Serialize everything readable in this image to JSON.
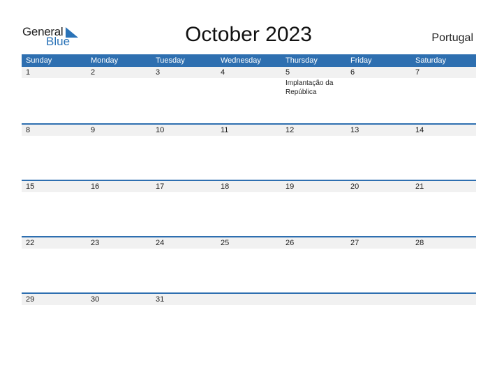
{
  "logo": {
    "line1": "General",
    "line2": "Blue"
  },
  "title": "October 2023",
  "country": "Portugal",
  "colors": {
    "header_bg": "#2e6fb0",
    "strip_bg": "#f1f1f1",
    "brand_blue": "#2a73b8"
  },
  "days": [
    "Sunday",
    "Monday",
    "Tuesday",
    "Wednesday",
    "Thursday",
    "Friday",
    "Saturday"
  ],
  "weeks": [
    {
      "dates": [
        "1",
        "2",
        "3",
        "4",
        "5",
        "6",
        "7"
      ],
      "events": [
        "",
        "",
        "",
        "",
        "Implantação da República",
        "",
        ""
      ]
    },
    {
      "dates": [
        "8",
        "9",
        "10",
        "11",
        "12",
        "13",
        "14"
      ],
      "events": [
        "",
        "",
        "",
        "",
        "",
        "",
        ""
      ]
    },
    {
      "dates": [
        "15",
        "16",
        "17",
        "18",
        "19",
        "20",
        "21"
      ],
      "events": [
        "",
        "",
        "",
        "",
        "",
        "",
        ""
      ]
    },
    {
      "dates": [
        "22",
        "23",
        "24",
        "25",
        "26",
        "27",
        "28"
      ],
      "events": [
        "",
        "",
        "",
        "",
        "",
        "",
        ""
      ]
    },
    {
      "dates": [
        "29",
        "30",
        "31",
        "",
        "",
        "",
        ""
      ],
      "events": [
        "",
        "",
        "",
        "",
        "",
        "",
        ""
      ]
    }
  ]
}
